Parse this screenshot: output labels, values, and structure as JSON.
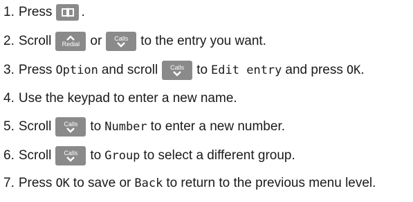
{
  "steps": [
    {
      "num": "1.",
      "t1": "Press",
      "t2": "."
    },
    {
      "num": "2.",
      "t1": "Scroll",
      "t2": "or",
      "t3": "to the entry you want."
    },
    {
      "num": "3.",
      "t1": "Press",
      "lcd1": "Option",
      "t2": "and scroll",
      "t3": "to",
      "lcd2": "Edit entry",
      "t4": "and press",
      "lcd3": "OK",
      "t5": "."
    },
    {
      "num": "4.",
      "t1": "Use the keypad to enter a new name."
    },
    {
      "num": "5.",
      "t1": "Scroll",
      "t2": "to",
      "lcd1": "Number",
      "t3": "to enter a new number."
    },
    {
      "num": "6.",
      "t1": "Scroll",
      "t2": "to",
      "lcd1": "Group",
      "t3": "to select a different group."
    },
    {
      "num": "7.",
      "t1": "Press",
      "lcd1": "OK",
      "t2": "to save or",
      "lcd2": "Back",
      "t3": "to return to the previous menu level."
    }
  ],
  "keys": {
    "redial_label": "Redial",
    "calls_label": "Calls",
    "book_icon": "phonebook-icon",
    "up_icon": "chevron-up-icon",
    "down_icon": "chevron-down-icon",
    "key_color": "#8a8a8a"
  }
}
